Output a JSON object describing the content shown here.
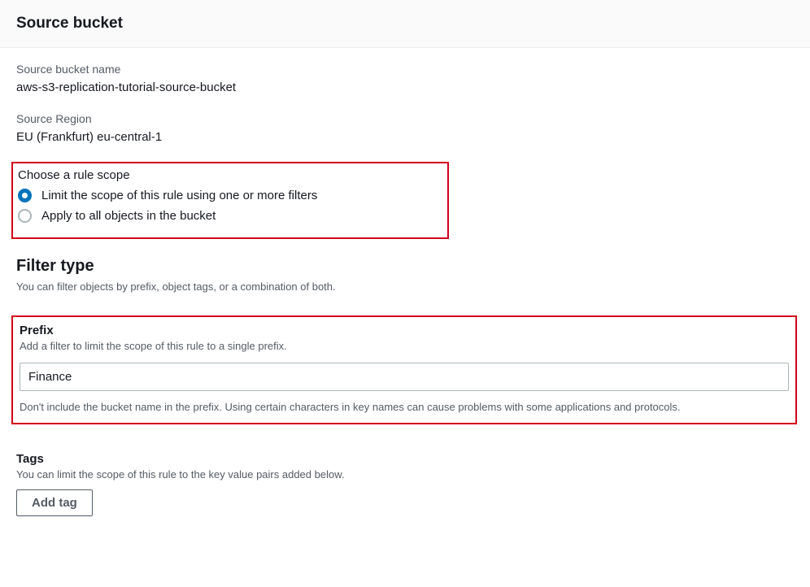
{
  "header": {
    "title": "Source bucket"
  },
  "bucket_name": {
    "label": "Source bucket name",
    "value": "aws-s3-replication-tutorial-source-bucket"
  },
  "region": {
    "label": "Source Region",
    "value": "EU (Frankfurt) eu-central-1"
  },
  "scope": {
    "title": "Choose a rule scope",
    "option1": "Limit the scope of this rule using one or more filters",
    "option2": "Apply to all objects in the bucket"
  },
  "filter_type": {
    "heading": "Filter type",
    "sub": "You can filter objects by prefix, object tags, or a combination of both."
  },
  "prefix": {
    "heading": "Prefix",
    "help": "Add a filter to limit the scope of this rule to a single prefix.",
    "value": "Finance",
    "post_help": "Don't include the bucket name in the prefix. Using certain characters in key names can cause problems with some applications and protocols."
  },
  "tags": {
    "heading": "Tags",
    "help": "You can limit the scope of this rule to the key value pairs added below.",
    "button": "Add tag"
  }
}
